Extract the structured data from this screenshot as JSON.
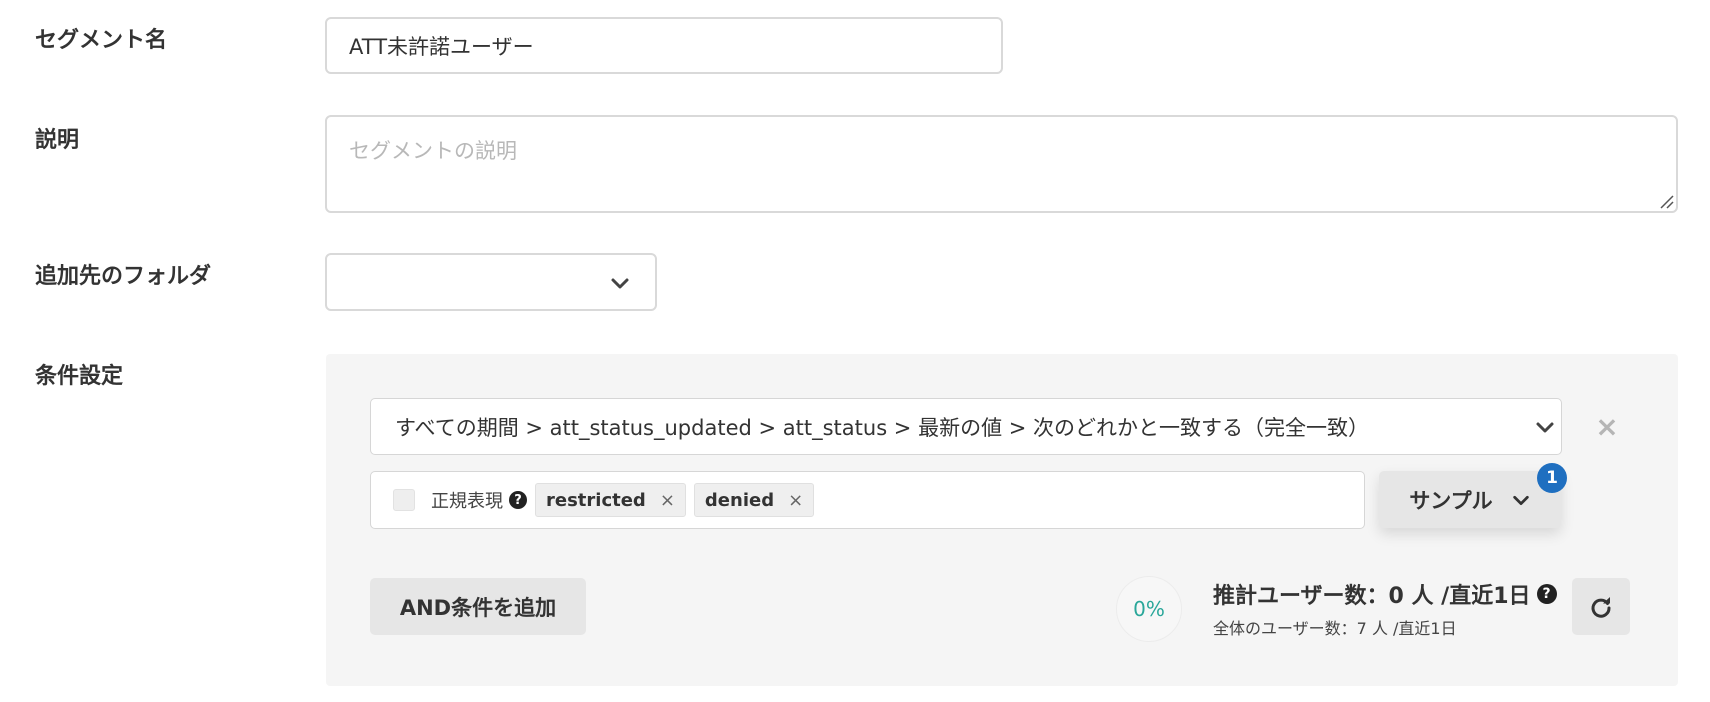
{
  "form": {
    "segment_name_label": "セグメント名",
    "segment_name_value": "ATT未許諾ユーザー",
    "description_label": "説明",
    "description_placeholder": "セグメントの説明",
    "folder_label": "追加先のフォルダ",
    "folder_value": "",
    "conditions_label": "条件設定"
  },
  "condition": {
    "path_text": "すべての期間 > att_status_updated > att_status > 最新の値 > 次のどれかと一致する（完全一致）",
    "regex_label": "正規表現",
    "regex_checked": false,
    "tags": [
      "restricted",
      "denied"
    ],
    "tag_remove_glyph": "×",
    "remove_glyph": "×",
    "sample_label": "サンプル",
    "sample_badge": "1"
  },
  "actions": {
    "add_and_label": "AND条件を追加"
  },
  "estimate": {
    "percent_text": "0%",
    "title": "推計ユーザー数：0 人 /直近1日",
    "subtitle": "全体のユーザー数：7 人 /直近1日"
  },
  "icons": {
    "help": "question-circle-icon",
    "chevron": "chevron-down-icon",
    "refresh": "refresh-icon",
    "close": "close-icon"
  },
  "colors": {
    "accent_teal": "#2aa79a",
    "badge_blue": "#1f6fc0",
    "panel_bg": "#f5f5f5"
  }
}
